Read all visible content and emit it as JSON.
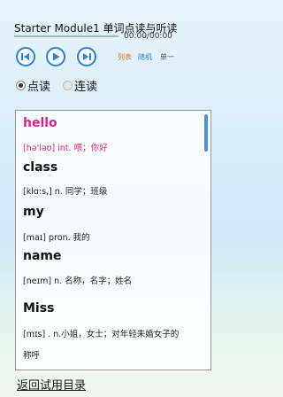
{
  "header": {
    "title": "Starter Module1 单词点读与听读",
    "time": "00:00/00:00",
    "progress": 0
  },
  "controls": {
    "prev_icon": "skip-previous-icon",
    "play_icon": "play-icon",
    "next_icon": "skip-next-icon",
    "options": [
      "列表",
      "随机",
      "单一"
    ]
  },
  "modes": [
    {
      "label": "点读",
      "selected": true
    },
    {
      "label": "连读",
      "selected": false
    }
  ],
  "words": [
    {
      "word": "hello",
      "def": "[hə'ləʊ] int. 喂；你好",
      "active": true
    },
    {
      "word": "class",
      "def": "[klɑ:s,] n. 同学；班级",
      "active": false
    },
    {
      "word": "my",
      "def": "[maɪ] pron. 我的",
      "active": false
    },
    {
      "word": "name",
      "def": "[neɪm] n. 名称，名字；姓名",
      "active": false
    },
    {
      "word": "Miss",
      "def": "[mɪs] . n.小姐，女士；对年轻未婚女子的",
      "def2": "称呼",
      "active": false
    }
  ],
  "footer": {
    "link": "返回试用目录"
  },
  "colors": {
    "accent": "#2f7fd1",
    "highlight": "#d6248f"
  }
}
